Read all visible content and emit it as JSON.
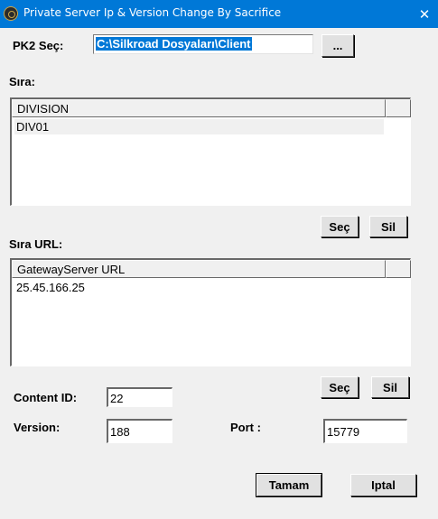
{
  "window": {
    "title": "Private Server Ip & Version Change By Sacrifice",
    "close_glyph": "✕"
  },
  "pk2": {
    "label": "PK2 Seç:",
    "value": "C:\\Silkroad Dosyaları\\Client",
    "browse_label": "..."
  },
  "division": {
    "label": "Sıra:",
    "column": "DIVISION",
    "rows": [
      "DIV01"
    ],
    "select_label": "Seç",
    "delete_label": "Sil"
  },
  "gateway": {
    "label": "Sıra URL:",
    "column": "GatewayServer URL",
    "rows": [
      "25.45.166.25"
    ],
    "select_label": "Seç",
    "delete_label": "Sil"
  },
  "fields": {
    "content_id_label": "Content ID:",
    "content_id_value": "22",
    "version_label": "Version:",
    "version_value": "188",
    "port_label": "Port :",
    "port_value": "15779"
  },
  "actions": {
    "ok_label": "Tamam",
    "cancel_label": "Iptal"
  }
}
